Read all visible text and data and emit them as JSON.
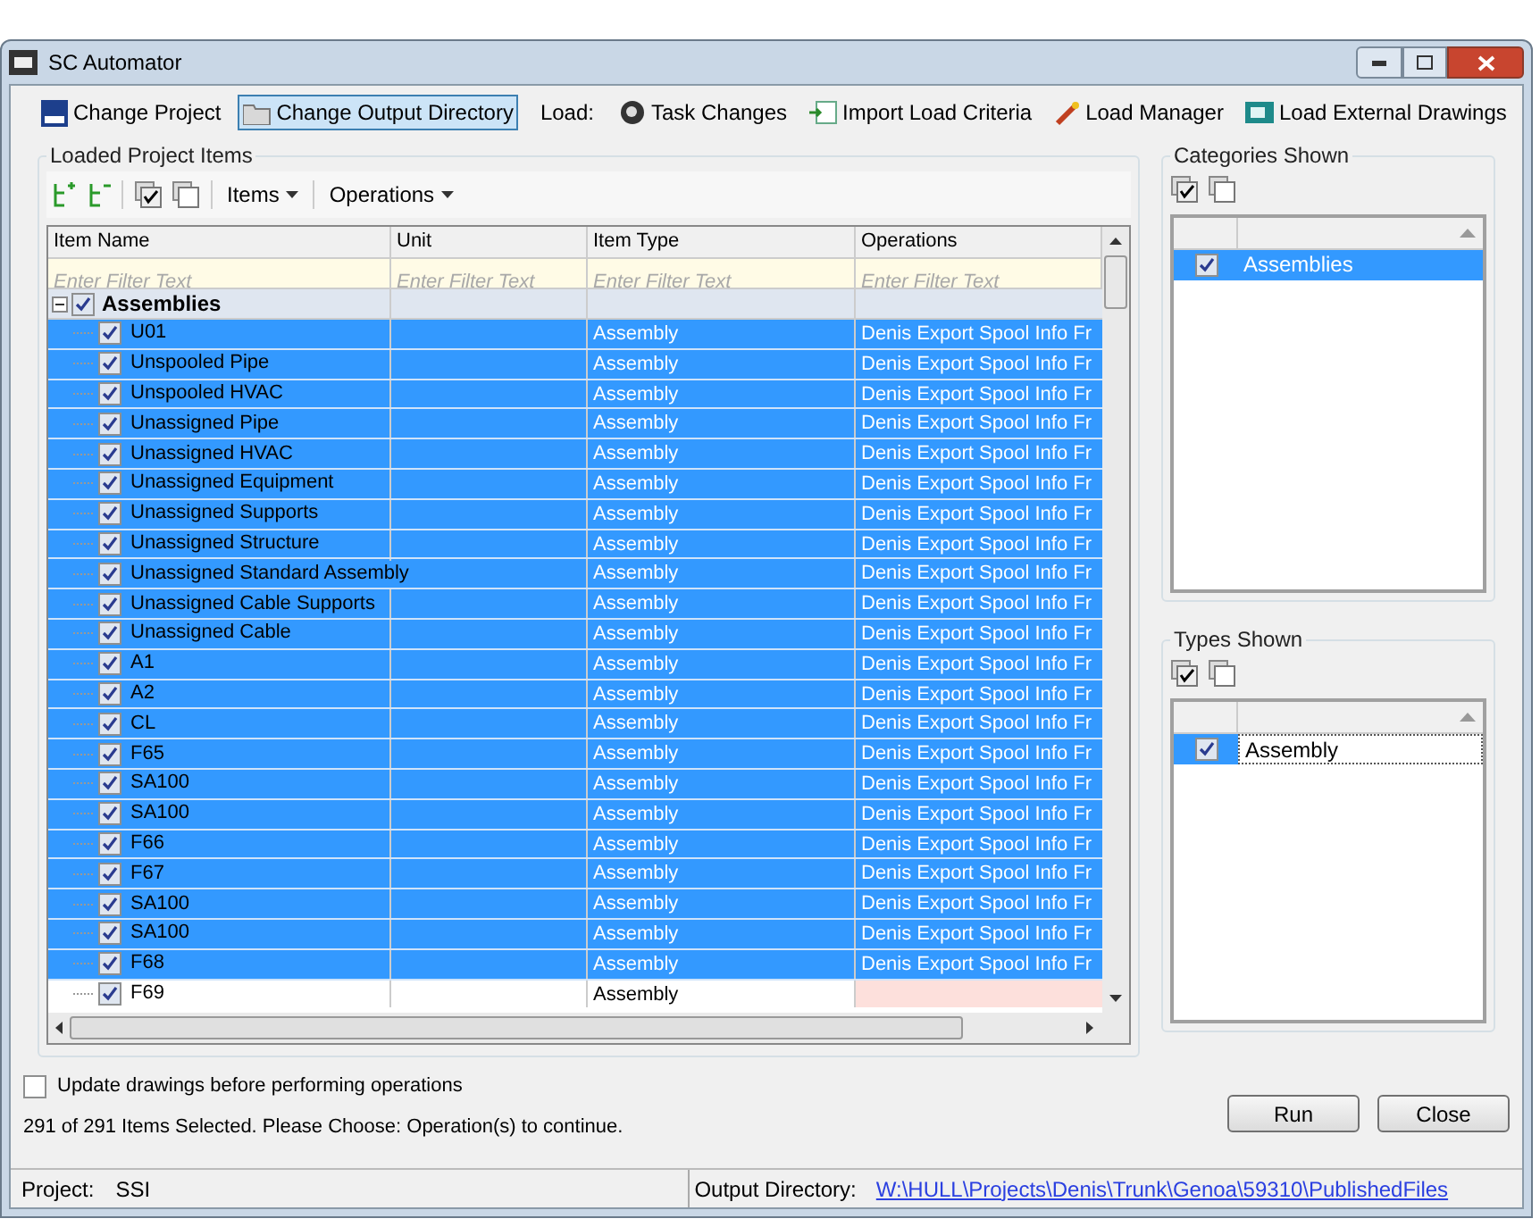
{
  "window": {
    "title": "SC Automator"
  },
  "toolbar": {
    "items": [
      {
        "kind": "button",
        "label": "Change Project",
        "selected": false
      },
      {
        "kind": "button",
        "label": "Change Output Directory",
        "selected": true
      },
      {
        "kind": "label",
        "label": "Load:"
      },
      {
        "kind": "button",
        "label": "Task Changes",
        "selected": false
      },
      {
        "kind": "button",
        "label": "Import Load Criteria",
        "selected": false
      },
      {
        "kind": "button",
        "label": "Load Manager",
        "selected": false
      },
      {
        "kind": "button",
        "label": "Load External Drawings",
        "selected": false
      }
    ]
  },
  "loaded_items": {
    "title": "Loaded Project Items",
    "menus": [
      "Items",
      "Operations"
    ],
    "columns": [
      "Item Name",
      "Unit",
      "Item Type",
      "Operations"
    ],
    "filter_placeholders": [
      "Enter Filter Text",
      "Enter Filter Text",
      "Enter Filter Text",
      "Enter Filter Text"
    ],
    "group": {
      "label": "Assemblies",
      "checked": true,
      "expanded": true
    },
    "rows": [
      {
        "name": "U01",
        "type": "Assembly",
        "operations": "Denis Export Spool Info Fr",
        "checked": true,
        "selected": true
      },
      {
        "name": "Unspooled Pipe",
        "type": "Assembly",
        "operations": "Denis Export Spool Info Fr",
        "checked": true,
        "selected": true
      },
      {
        "name": "Unspooled HVAC",
        "type": "Assembly",
        "operations": "Denis Export Spool Info Fr",
        "checked": true,
        "selected": true
      },
      {
        "name": "Unassigned Pipe",
        "type": "Assembly",
        "operations": "Denis Export Spool Info Fr",
        "checked": true,
        "selected": true
      },
      {
        "name": "Unassigned HVAC",
        "type": "Assembly",
        "operations": "Denis Export Spool Info Fr",
        "checked": true,
        "selected": true
      },
      {
        "name": "Unassigned Equipment",
        "type": "Assembly",
        "operations": "Denis Export Spool Info Fr",
        "checked": true,
        "selected": true
      },
      {
        "name": "Unassigned Supports",
        "type": "Assembly",
        "operations": "Denis Export Spool Info Fr",
        "checked": true,
        "selected": true
      },
      {
        "name": "Unassigned Structure",
        "type": "Assembly",
        "operations": "Denis Export Spool Info Fr",
        "checked": true,
        "selected": true
      },
      {
        "name": "Unassigned Standard Assembly",
        "type": "Assembly",
        "operations": "Denis Export Spool Info Fr",
        "checked": true,
        "selected": true
      },
      {
        "name": "Unassigned Cable Supports",
        "type": "Assembly",
        "operations": "Denis Export Spool Info Fr",
        "checked": true,
        "selected": true
      },
      {
        "name": "Unassigned Cable",
        "type": "Assembly",
        "operations": "Denis Export Spool Info Fr",
        "checked": true,
        "selected": true
      },
      {
        "name": "A1",
        "type": "Assembly",
        "operations": "Denis Export Spool Info Fr",
        "checked": true,
        "selected": true
      },
      {
        "name": "A2",
        "type": "Assembly",
        "operations": "Denis Export Spool Info Fr",
        "checked": true,
        "selected": true
      },
      {
        "name": "CL",
        "type": "Assembly",
        "operations": "Denis Export Spool Info Fr",
        "checked": true,
        "selected": true
      },
      {
        "name": "F65",
        "type": "Assembly",
        "operations": "Denis Export Spool Info Fr",
        "checked": true,
        "selected": true
      },
      {
        "name": "SA100",
        "type": "Assembly",
        "operations": "Denis Export Spool Info Fr",
        "checked": true,
        "selected": true
      },
      {
        "name": "SA100",
        "type": "Assembly",
        "operations": "Denis Export Spool Info Fr",
        "checked": true,
        "selected": true
      },
      {
        "name": "F66",
        "type": "Assembly",
        "operations": "Denis Export Spool Info Fr",
        "checked": true,
        "selected": true
      },
      {
        "name": "F67",
        "type": "Assembly",
        "operations": "Denis Export Spool Info Fr",
        "checked": true,
        "selected": true
      },
      {
        "name": "SA100",
        "type": "Assembly",
        "operations": "Denis Export Spool Info Fr",
        "checked": true,
        "selected": true
      },
      {
        "name": "SA100",
        "type": "Assembly",
        "operations": "Denis Export Spool Info Fr",
        "checked": true,
        "selected": true
      },
      {
        "name": "F68",
        "type": "Assembly",
        "operations": "Denis Export Spool Info Fr",
        "checked": true,
        "selected": true
      },
      {
        "name": "F69",
        "type": "Assembly",
        "checked": true,
        "selected": false
      }
    ]
  },
  "categories_shown": {
    "title": "Categories Shown",
    "items": [
      {
        "label": "Assemblies",
        "checked": true,
        "selected": true
      }
    ]
  },
  "types_shown": {
    "title": "Types Shown",
    "items": [
      {
        "label": "Assembly",
        "checked": true,
        "selected": false
      }
    ]
  },
  "update_drawings": {
    "label": "Update drawings before performing operations",
    "checked": false
  },
  "status_message": "291 of 291 Items Selected. Please Choose: Operation(s) to continue.",
  "buttons": [
    "Run",
    "Close"
  ],
  "status_bar": {
    "project_label": "Project:",
    "project": "SSI",
    "output_label": "Output Directory:",
    "output_path": "W:\\HULL\\Projects\\Denis\\Trunk\\Genoa\\59310\\PublishedFiles"
  }
}
